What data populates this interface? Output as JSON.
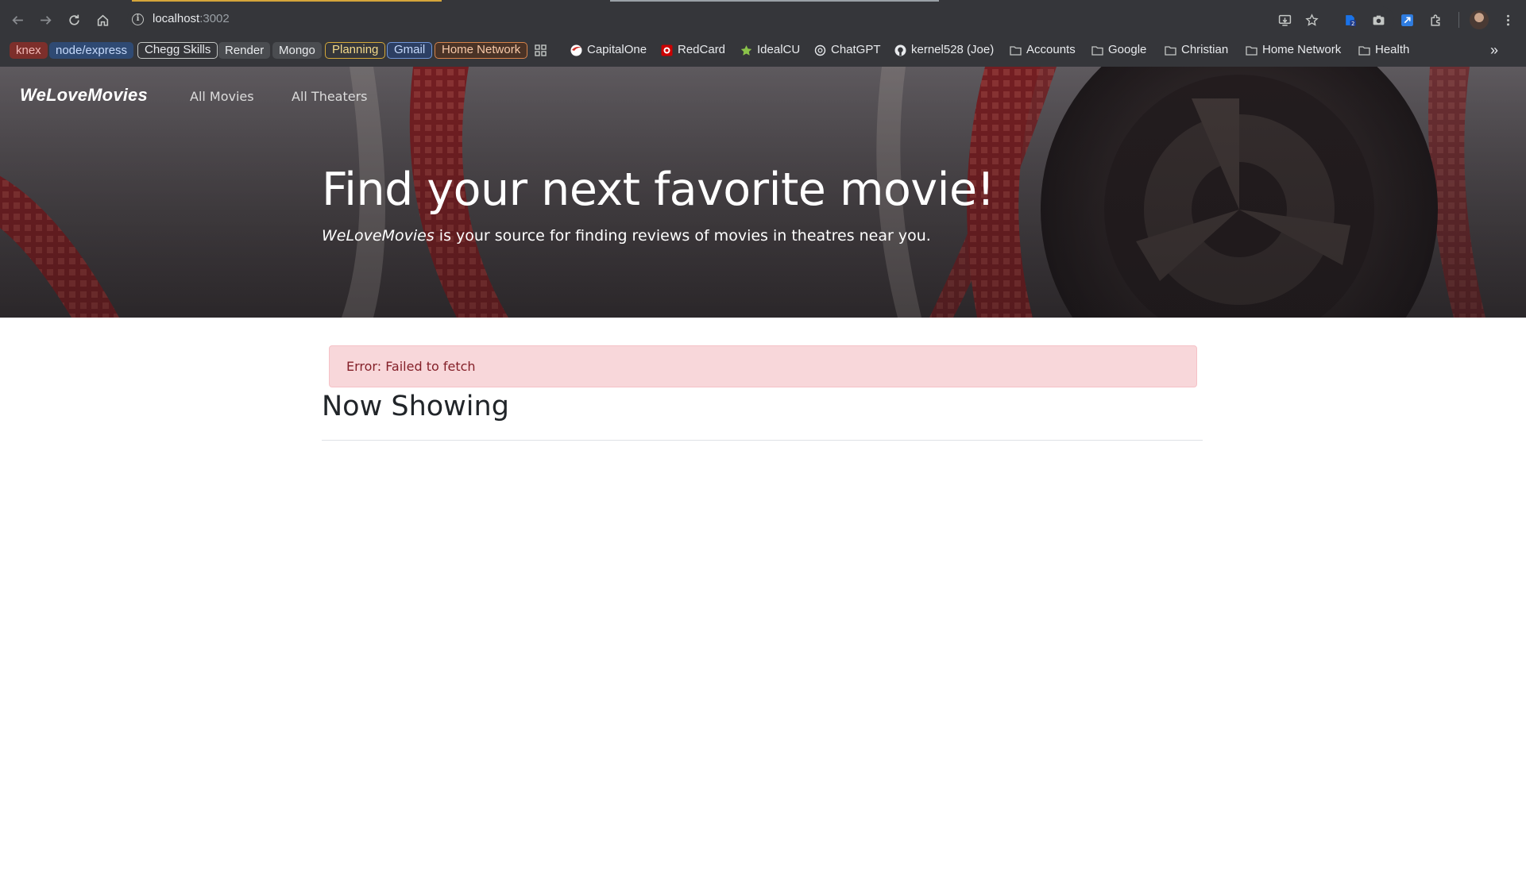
{
  "browser": {
    "url_host": "localhost",
    "url_port": ":3002",
    "icons": {
      "back": "back-arrow-icon",
      "forward": "forward-arrow-icon",
      "reload": "reload-icon",
      "home": "home-icon",
      "site_info": "info-icon",
      "install": "install-app-icon",
      "bookmark": "star-icon",
      "extensions": "puzzle-icon",
      "menu": "kebab-menu-icon"
    }
  },
  "bookmarks": {
    "tags": [
      {
        "label": "knex",
        "color": "#c2453e"
      },
      {
        "label": "node/express",
        "color": "#4a6fa5"
      },
      {
        "label": "Chegg Skills",
        "color": "#5f6368"
      },
      {
        "label": "Render",
        "color": "#5f6368"
      },
      {
        "label": "Mongo",
        "color": "#5f6368"
      },
      {
        "label": "Planning",
        "color": "#a8872c"
      },
      {
        "label": "Gmail",
        "color": "#3d5e9e"
      },
      {
        "label": "Home Network",
        "color": "#b5632f"
      }
    ],
    "links": [
      {
        "label": "CapitalOne",
        "icon": "capitalone-icon"
      },
      {
        "label": "RedCard",
        "icon": "redcard-icon"
      },
      {
        "label": "IdealCU",
        "icon": "star-icon"
      },
      {
        "label": "ChatGPT",
        "icon": "chatgpt-icon"
      },
      {
        "label": "kernel528 (Joe)",
        "icon": "github-icon"
      },
      {
        "label": "Accounts",
        "icon": "folder-icon"
      },
      {
        "label": "Google",
        "icon": "folder-icon"
      },
      {
        "label": "Christian",
        "icon": "folder-icon"
      },
      {
        "label": "Home Network",
        "icon": "folder-icon"
      },
      {
        "label": "Health",
        "icon": "folder-icon"
      }
    ],
    "overflow": "»"
  },
  "site": {
    "brand": "WeLoveMovies",
    "nav": [
      "All Movies",
      "All Theaters"
    ],
    "hero_title": "Find your next favorite movie!",
    "hero_sub_brand": "WeLoveMovies",
    "hero_sub_rest": " is your source for finding reviews of movies in theatres near you.",
    "error": "Error: Failed to fetch",
    "section_title": "Now Showing"
  }
}
